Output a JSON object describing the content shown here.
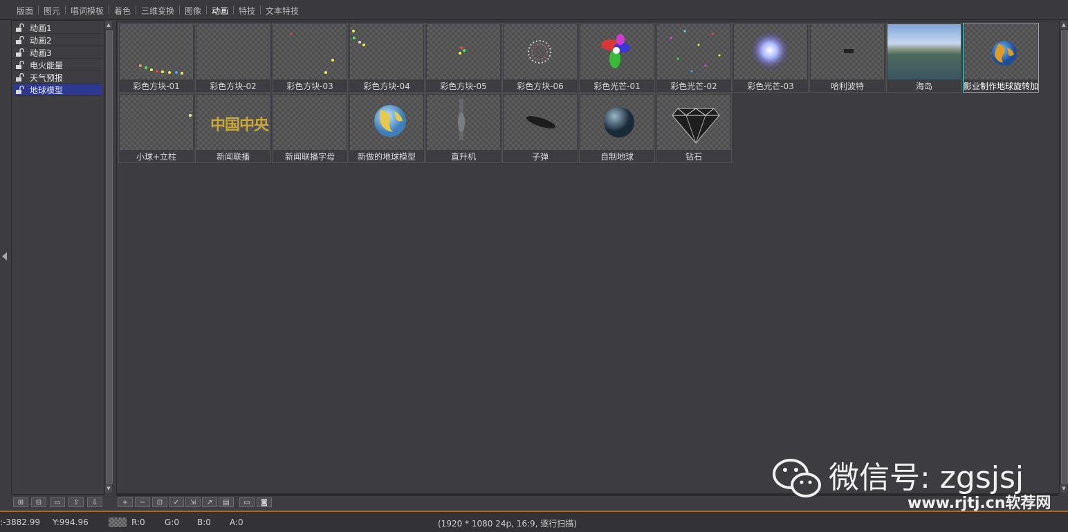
{
  "tabs": [
    {
      "label": "版面"
    },
    {
      "label": "图元"
    },
    {
      "label": "唱词模板"
    },
    {
      "label": "着色"
    },
    {
      "label": "三维变换"
    },
    {
      "label": "图像"
    },
    {
      "label": "动画",
      "active": true
    },
    {
      "label": "特技"
    },
    {
      "label": "文本特技"
    }
  ],
  "tree": {
    "items": [
      {
        "label": "动画1"
      },
      {
        "label": "动画2"
      },
      {
        "label": "动画3"
      },
      {
        "label": "电火能量"
      },
      {
        "label": "天气预报"
      },
      {
        "label": "地球模型",
        "selected": true
      }
    ]
  },
  "thumbnails": [
    {
      "label": "彩色方块-01",
      "icon": "colored-blocks"
    },
    {
      "label": "彩色方块-02",
      "icon": "empty"
    },
    {
      "label": "彩色方块-03",
      "icon": "colored-blocks"
    },
    {
      "label": "彩色方块-04",
      "icon": "colored-blocks"
    },
    {
      "label": "彩色方块-05",
      "icon": "colored-blocks"
    },
    {
      "label": "彩色方块-06",
      "icon": "particle-ring"
    },
    {
      "label": "彩色光芒-01",
      "icon": "rainbow-glow"
    },
    {
      "label": "彩色光芒-02",
      "icon": "scatter-dots"
    },
    {
      "label": "彩色光芒-03",
      "icon": "light-burst"
    },
    {
      "label": "哈利波特",
      "icon": "dark-object"
    },
    {
      "label": "海岛",
      "icon": "island-photo"
    },
    {
      "label": "影业制作地球旋转加",
      "icon": "globe",
      "selected": true
    },
    {
      "label": "小球+立柱",
      "icon": "small-ball"
    },
    {
      "label": "新闻联播",
      "icon": "cctv-text"
    },
    {
      "label": "新闻联播字母",
      "icon": "empty"
    },
    {
      "label": "新做的地球模型",
      "icon": "globe-large"
    },
    {
      "label": "直升机",
      "icon": "helicopter"
    },
    {
      "label": "子弹",
      "icon": "bullet"
    },
    {
      "label": "自制地球",
      "icon": "dark-globe"
    },
    {
      "label": "钻石",
      "icon": "diamond"
    }
  ],
  "cctv_text": "中国中央",
  "status": {
    "x": ":-3882.99",
    "y": "Y:994.96",
    "r": "R:0",
    "g": "G:0",
    "b": "B:0",
    "a": "A:0",
    "format": "(1920 * 1080 24p, 16:9, 逐行扫描)"
  },
  "watermark": {
    "wechat": "微信号: zgsjsj",
    "site": "www.rjtj.cn软荐网"
  },
  "colors": {
    "background": "#3d3c40",
    "selection": "#2d3990",
    "thumb_selected_border": "#3fd5d3",
    "status_divider": "#b06a1a"
  }
}
